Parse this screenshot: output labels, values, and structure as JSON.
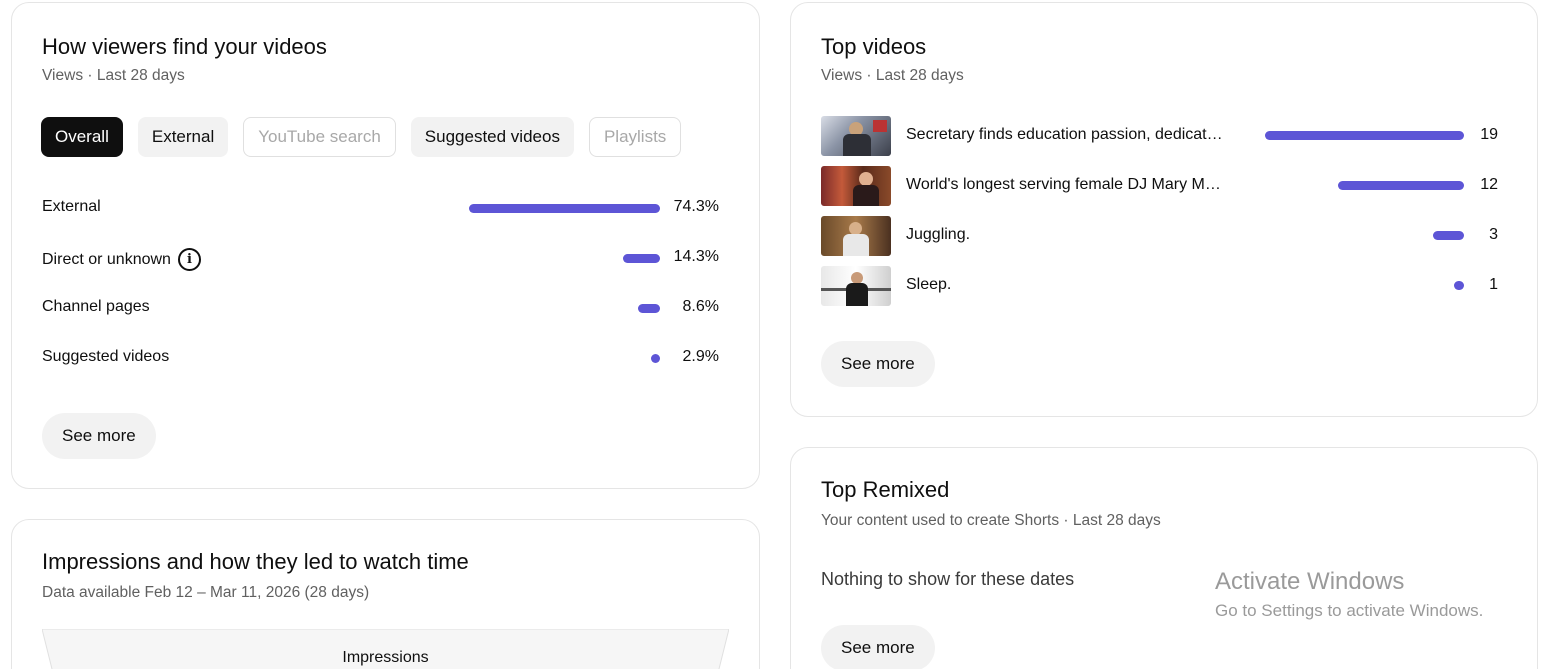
{
  "traffic_card": {
    "title": "How viewers find your videos",
    "subtitle": "Views · Last 28 days",
    "chips": [
      {
        "label": "Overall",
        "state": "selected"
      },
      {
        "label": "External",
        "state": "filled"
      },
      {
        "label": "YouTube search",
        "state": "outline"
      },
      {
        "label": "Suggested videos",
        "state": "filled"
      },
      {
        "label": "Playlists",
        "state": "outline"
      }
    ],
    "rows": [
      {
        "label": "External",
        "value": "74.3%",
        "fraction": 0.743
      },
      {
        "label": "Direct or unknown",
        "value": "14.3%",
        "fraction": 0.143,
        "icon": "info-icon"
      },
      {
        "label": "Channel pages",
        "value": "8.6%",
        "fraction": 0.086
      },
      {
        "label": "Suggested videos",
        "value": "2.9%",
        "fraction": 0.029
      }
    ],
    "see_more": "See more"
  },
  "top_videos_card": {
    "title": "Top videos",
    "subtitle": "Views · Last 28 days",
    "videos": [
      {
        "title": "Secretary finds education passion, dedicat…",
        "views": "19",
        "count": 19
      },
      {
        "title": "World's longest serving female DJ Mary M…",
        "views": "12",
        "count": 12
      },
      {
        "title": "Juggling.",
        "views": "3",
        "count": 3
      },
      {
        "title": "Sleep.",
        "views": "1",
        "count": 1
      }
    ],
    "see_more": "See more"
  },
  "remix_card": {
    "title": "Top Remixed",
    "subtitle": "Your content used to create Shorts · Last 28 days",
    "empty_text": "Nothing to show for these dates",
    "see_more": "See more"
  },
  "impressions_card": {
    "title": "Impressions and how they led to watch time",
    "subtitle": "Data available Feb 12 – Mar 11, 2026 (28 days)",
    "funnel_label": "Impressions"
  },
  "watermark": {
    "title": "Activate Windows",
    "subtitle": "Go to Settings to activate Windows."
  },
  "colors": {
    "bar": "#5d55d6",
    "chip_selected": "#0f0f0f",
    "chip_filled": "#f2f2f2"
  }
}
